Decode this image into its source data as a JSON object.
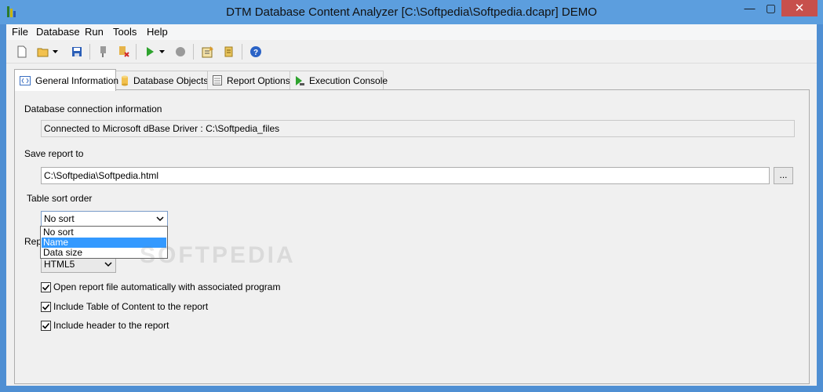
{
  "window": {
    "title": "DTM Database Content Analyzer [C:\\Softpedia\\Softpedia.dcapr] DEMO",
    "minimize": "—",
    "maximize": "▢",
    "close": "✕"
  },
  "menu": [
    "File",
    "Database",
    "Run",
    "Tools",
    "Help"
  ],
  "toolbar": {
    "icons": [
      "new-file-icon",
      "open-folder-icon",
      "save-icon",
      "connect-icon",
      "disconnect-icon",
      "run-icon",
      "stop-icon",
      "report-options-icon",
      "script-icon",
      "help-icon"
    ]
  },
  "tabs": [
    {
      "label": "General Information",
      "active": true
    },
    {
      "label": "Database Objects",
      "active": false
    },
    {
      "label": "Report Options",
      "active": false
    },
    {
      "label": "Execution Console",
      "active": false
    }
  ],
  "general": {
    "connection_label": "Database connection information",
    "connection_value": "Connected to Microsoft dBase Driver : C:\\Softpedia_files",
    "save_label": "Save report to",
    "save_value": "C:\\Softpedia\\Softpedia.html",
    "browse_label": "...",
    "sort_label": "Table sort order",
    "sort_value": "No sort",
    "sort_options": [
      "No sort",
      "Name",
      "Data size"
    ],
    "sort_highlighted": "Name",
    "format_label_partial": "Rep",
    "format_value": "HTML5",
    "options": [
      {
        "label": "Open report file automatically with associated program",
        "checked": true
      },
      {
        "label": "Include Table of Content to the report",
        "checked": true
      },
      {
        "label": "Include header to the report",
        "checked": true
      }
    ]
  },
  "watermark": "SOFTPEDIA"
}
